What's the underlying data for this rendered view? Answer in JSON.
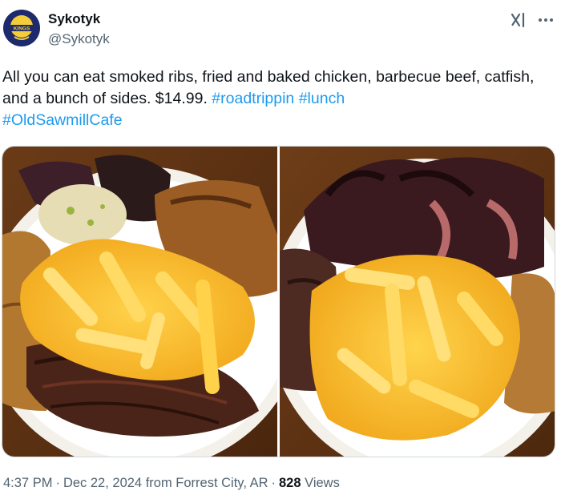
{
  "author": {
    "display_name": "Sykotyk",
    "handle": "@Sykotyk",
    "avatar_icon": "avatar-logo",
    "avatar_text": "KINGS"
  },
  "header_actions": {
    "grok_icon": "grok-icon",
    "more_icon": "more-options-icon"
  },
  "post": {
    "text": "All you can eat smoked ribs, fried and baked chicken, barbecue beef, catfish, and a bunch of sides. $14.99.",
    "hashtags": [
      "#roadtrippin",
      "#lunch",
      "#OldSawmillCafe"
    ]
  },
  "media": [
    {
      "kind": "photo",
      "subject": "plate-left"
    },
    {
      "kind": "photo",
      "subject": "plate-right"
    }
  ],
  "meta": {
    "time": "4:37 PM",
    "date": "Dec 22, 2024",
    "location": "from Forrest City, AR",
    "views_count": "828",
    "views_label": "Views"
  },
  "colors": {
    "text": "#0f1419",
    "secondary": "#536471",
    "link": "#1d9bf0"
  }
}
